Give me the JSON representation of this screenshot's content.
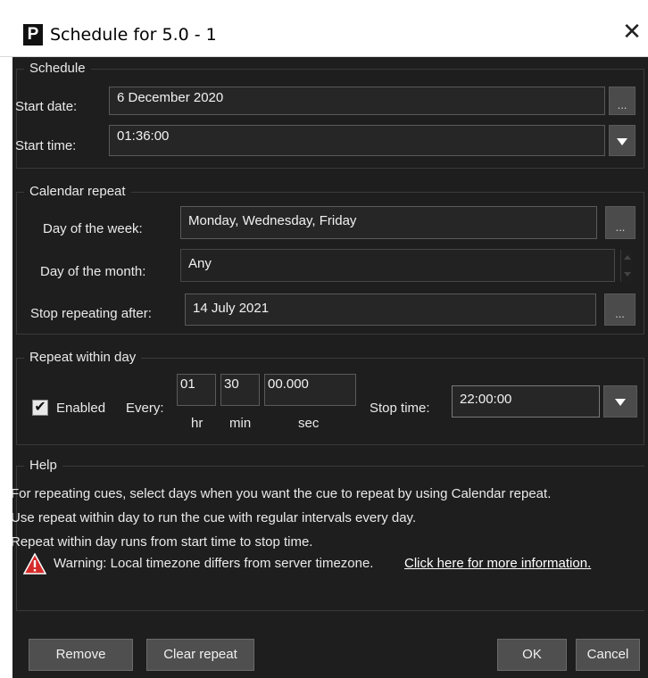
{
  "window": {
    "title": "Schedule for 5.0 - 1",
    "app_icon_letter": "P",
    "close_glyph": "✕"
  },
  "schedule": {
    "legend": "Schedule",
    "start_date_label": "Start date:",
    "start_date_value": "6 December 2020",
    "start_time_label": "Start time:",
    "start_time_value": "01:36:00",
    "ellipsis": "..."
  },
  "calendar": {
    "legend": "Calendar repeat",
    "dow_label": "Day of the week:",
    "dow_value": "Monday, Wednesday, Friday",
    "dom_label": "Day of the month:",
    "dom_value": "Any",
    "stop_label": "Stop repeating after:",
    "stop_value": "14 July 2021",
    "ellipsis": "..."
  },
  "within_day": {
    "legend": "Repeat within day",
    "enabled_label": "Enabled",
    "enabled_checked": true,
    "every_label": "Every:",
    "hr_value": "01",
    "min_value": "30",
    "sec_value": "00.000",
    "hr_unit": "hr",
    "min_unit": "min",
    "sec_unit": "sec",
    "stop_time_label": "Stop time:",
    "stop_time_value": "22:00:00"
  },
  "help": {
    "legend": "Help",
    "line1": "For repeating cues, select days when you want the cue to repeat by using Calendar repeat.",
    "line2": "Use repeat within day to run the cue with regular intervals every day.",
    "line3": "Repeat within day runs from start time to stop time.",
    "warning_text": "Warning: Local timezone differs from server timezone.",
    "warning_link": "Click here for more information."
  },
  "buttons": {
    "remove": "Remove",
    "clear_repeat": "Clear repeat",
    "ok": "OK",
    "cancel": "Cancel"
  },
  "colors": {
    "dialog_bg": "#1e1e1e",
    "button_bg": "#4f4f4f",
    "warning_red": "#d62b2b"
  }
}
